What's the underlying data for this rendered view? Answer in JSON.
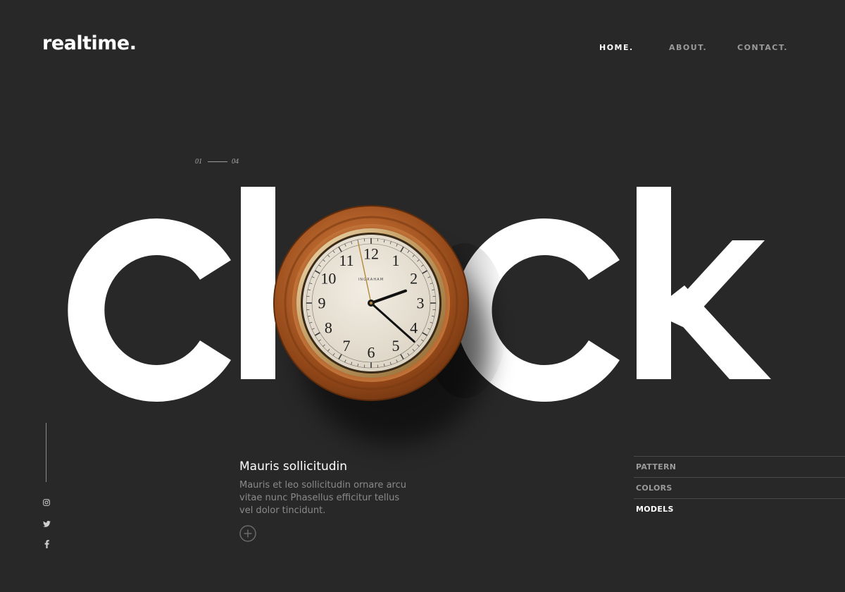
{
  "brand": {
    "logo": "realtime."
  },
  "nav": [
    {
      "label": "HOME.",
      "active": true
    },
    {
      "label": "ABOUT.",
      "active": false
    },
    {
      "label": "CONTACT.",
      "active": false
    }
  ],
  "slider": {
    "current": "01",
    "total": "04"
  },
  "hero": {
    "word": "clock",
    "clock": {
      "brand": "INGRAHAM",
      "numerals": [
        "12",
        "1",
        "2",
        "3",
        "4",
        "5",
        "6",
        "7",
        "8",
        "9",
        "10",
        "11"
      ],
      "time": {
        "hours": 2,
        "minutes": 21,
        "seconds": 58
      }
    }
  },
  "feature": {
    "title": "Mauris sollicitudin",
    "body": "Mauris et leo sollicitudin ornare arcu vitae nunc Phasellus efficitur tellus vel dolor tincidunt."
  },
  "side_menu": [
    {
      "label": "PATTERN",
      "active": false
    },
    {
      "label": "COLORS",
      "active": false
    },
    {
      "label": "MODELS",
      "active": true
    }
  ],
  "social": [
    "instagram-icon",
    "twitter-icon",
    "facebook-icon"
  ],
  "colors": {
    "background": "#282828",
    "text": "#ffffff",
    "muted": "#9a9a9a",
    "wood": "#b5642a",
    "dial": "#e9e3d8"
  }
}
